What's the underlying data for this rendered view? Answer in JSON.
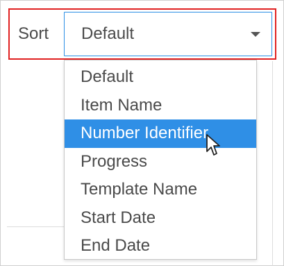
{
  "sort": {
    "label": "Sort",
    "selected_value": "Default",
    "options": [
      {
        "label": "Default"
      },
      {
        "label": "Item Name"
      },
      {
        "label": "Number Identifier"
      },
      {
        "label": "Progress"
      },
      {
        "label": "Template Name"
      },
      {
        "label": "Start Date"
      },
      {
        "label": "End Date"
      }
    ],
    "highlighted_option": "Number Identifier"
  },
  "colors": {
    "highlight_border": "#e02020",
    "select_border": "#2b8fe5",
    "option_hover_bg": "#2f8fe6",
    "text": "#4a4a4a"
  },
  "icons": {
    "caret": "caret-down-icon",
    "cursor": "mouse-pointer-icon"
  }
}
